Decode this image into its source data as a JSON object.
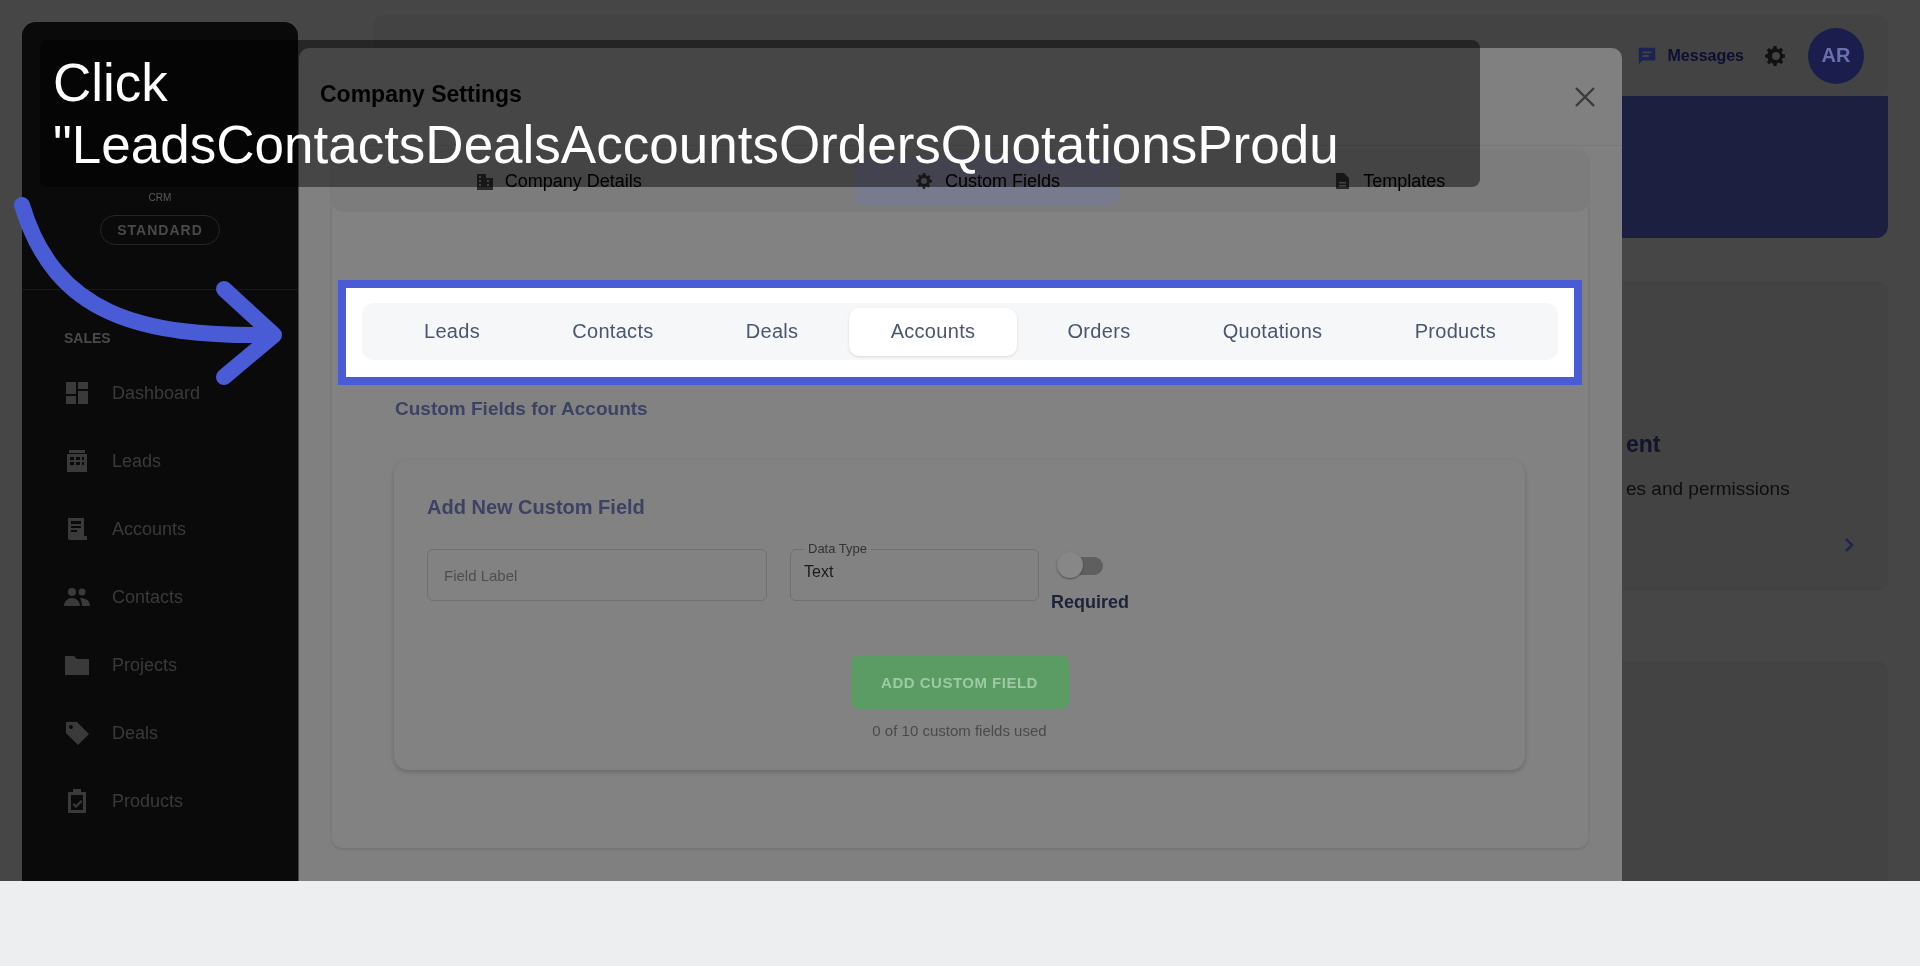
{
  "caption": {
    "text": "Click \"LeadsContactsDealsAccountsOrdersQuotationsProdu"
  },
  "sidebar": {
    "brand_sub": "CRM",
    "plan": "STANDARD",
    "section": "SALES",
    "items": [
      {
        "label": "Dashboard",
        "kind": "dashboard"
      },
      {
        "label": "Leads",
        "kind": "table"
      },
      {
        "label": "Accounts",
        "kind": "ledger"
      },
      {
        "label": "Contacts",
        "kind": "people"
      },
      {
        "label": "Projects",
        "kind": "folder"
      },
      {
        "label": "Deals",
        "kind": "tag"
      },
      {
        "label": "Products",
        "kind": "clipboard"
      }
    ]
  },
  "header": {
    "messages": "Messages",
    "avatar": "AR"
  },
  "side_card": {
    "title": "ent",
    "subtitle": "es and permissions"
  },
  "modal": {
    "title": "Company Settings",
    "tabs": [
      {
        "label": "Company Details",
        "kind": "building",
        "selected": false
      },
      {
        "label": "Custom Fields",
        "kind": "gear",
        "selected": true
      },
      {
        "label": "Templates",
        "kind": "document",
        "selected": false
      }
    ],
    "entity_tabs": [
      {
        "label": "Leads",
        "selected": false
      },
      {
        "label": "Contacts",
        "selected": false
      },
      {
        "label": "Deals",
        "selected": false
      },
      {
        "label": "Accounts",
        "selected": true
      },
      {
        "label": "Orders",
        "selected": false
      },
      {
        "label": "Quotations",
        "selected": false
      },
      {
        "label": "Products",
        "selected": false
      }
    ],
    "section_title": "Custom Fields for Accounts",
    "form": {
      "title": "Add New Custom Field",
      "field_label": {
        "placeholder": "Field Label"
      },
      "data_type": {
        "label": "Data Type",
        "value": "Text"
      },
      "required": {
        "label": "Required",
        "on": false
      },
      "button": "ADD CUSTOM FIELD",
      "usage": "0 of 10 custom fields used"
    }
  }
}
